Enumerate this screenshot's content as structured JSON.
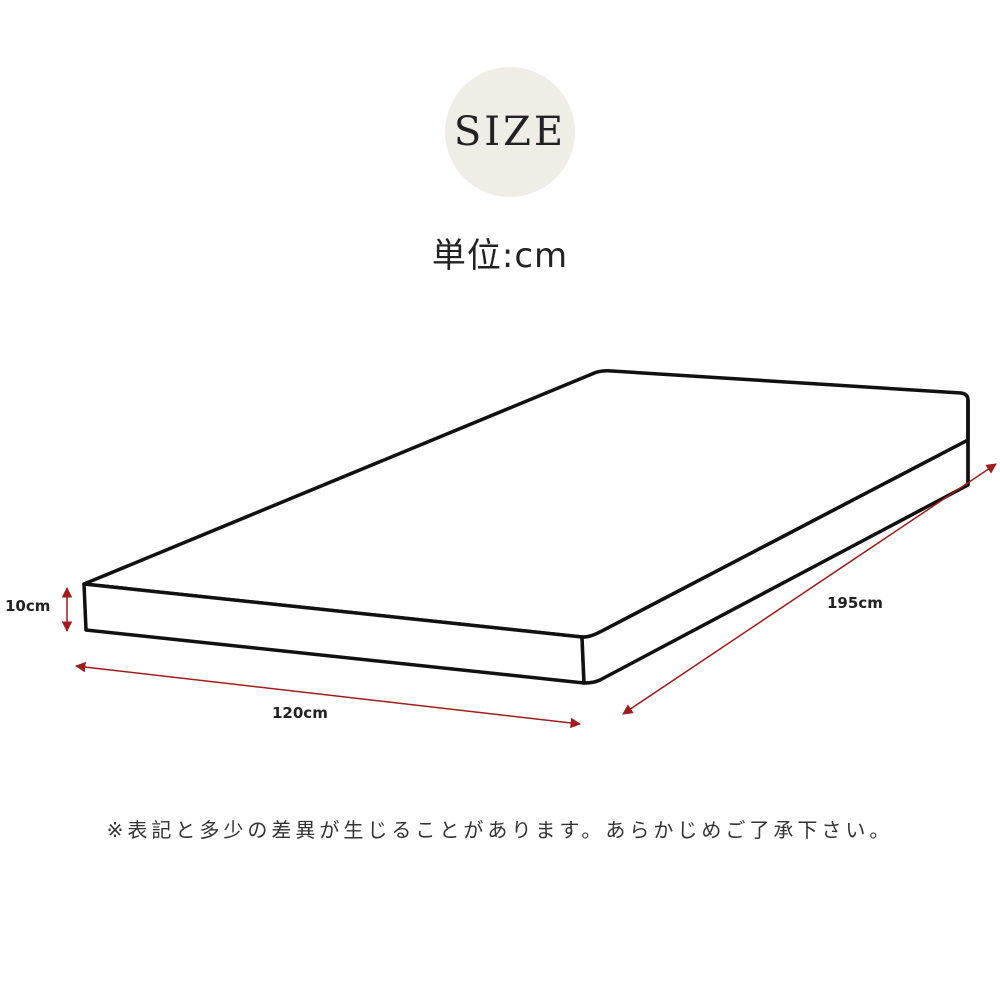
{
  "header": {
    "badge_text": "SIZE",
    "badge_color": "#efede6",
    "unit_label": "単位:cm"
  },
  "dimensions": {
    "height_label": "10cm",
    "width_label": "120cm",
    "length_label": "195cm",
    "arrow_color": "#a11c1c"
  },
  "note": "※表記と多少の差異が生じることがあります。あらかじめご了承下さい。"
}
